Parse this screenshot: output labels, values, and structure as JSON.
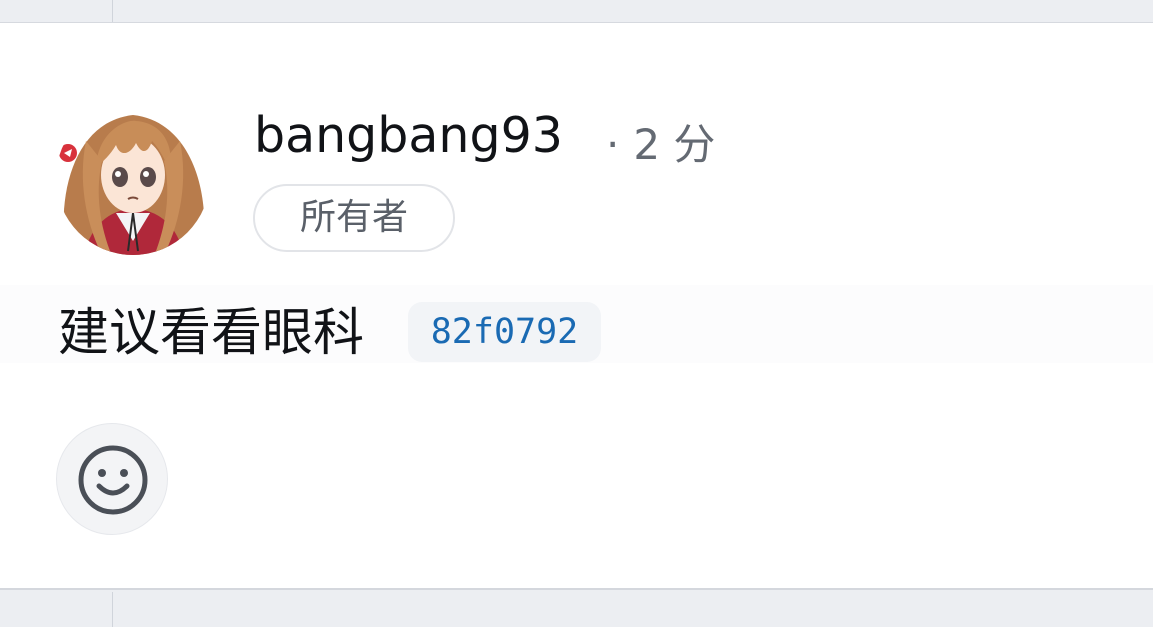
{
  "comment": {
    "author": "bangbang93",
    "separator": "·",
    "time": "2 分",
    "role": "所有者",
    "body": "建议看看眼科",
    "commit_ref": "82f0792"
  },
  "reactions": {
    "add_icon": "smiley-icon"
  }
}
